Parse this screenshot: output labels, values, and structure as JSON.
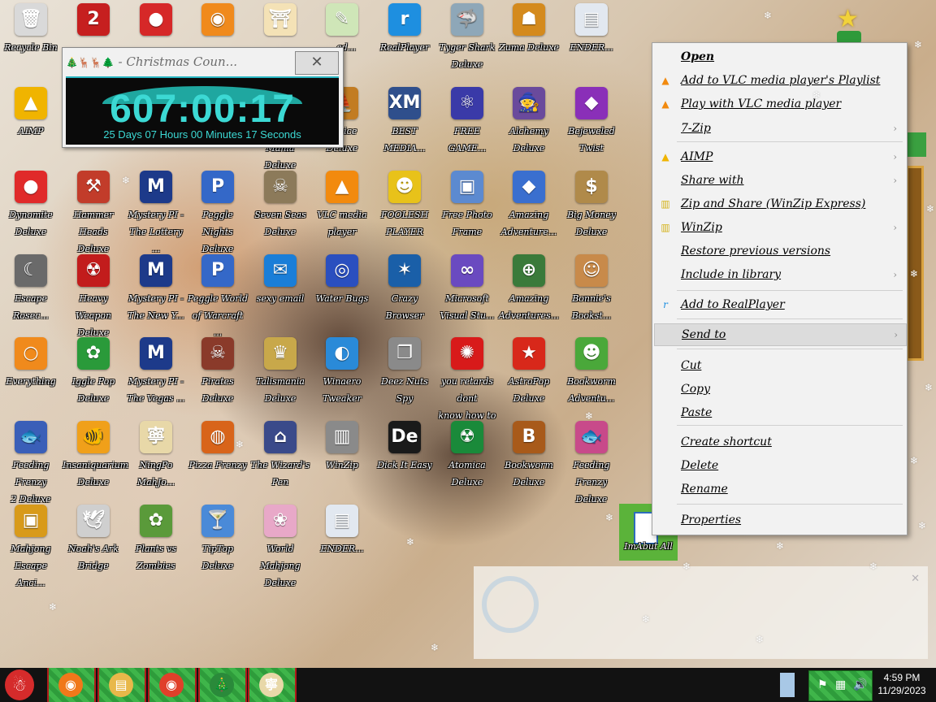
{
  "desktop": {
    "icons": [
      {
        "label": "Recycle Bin",
        "glyph": "🗑",
        "color": "#d9d9d9",
        "shortcut": false
      },
      {
        "label": "",
        "glyph": "2",
        "color": "#c61f1f",
        "shortcut": true
      },
      {
        "label": "",
        "glyph": "●",
        "color": "#d62828",
        "shortcut": true
      },
      {
        "label": "",
        "glyph": "◉",
        "color": "#f08a1c",
        "shortcut": true
      },
      {
        "label": "",
        "glyph": "⛩",
        "color": "#f4e2b6",
        "shortcut": true
      },
      {
        "label": "...ad...",
        "glyph": "✎",
        "color": "#cfe6b8",
        "shortcut": true
      },
      {
        "label": "RealPlayer",
        "glyph": "r",
        "color": "#1e8fe0",
        "shortcut": true
      },
      {
        "label": "Tyger Shark\nDeluxe",
        "glyph": "🦈",
        "color": "#8ea7b8",
        "shortcut": true
      },
      {
        "label": "Zuma Deluxe",
        "glyph": "☗",
        "color": "#d48a1d",
        "shortcut": true
      },
      {
        "label": "ENDER...",
        "glyph": "▤",
        "color": "#e2e8f0",
        "shortcut": true
      },
      {
        "label": "AIMP",
        "glyph": "▲",
        "color": "#f0b400",
        "shortcut": true
      },
      {
        "label": "Deluxe",
        "glyph": "",
        "color": "rgba(0,0,0,0)",
        "shortcut": false
      },
      {
        "label": "Deluxe",
        "glyph": "",
        "color": "rgba(0,0,0,0)",
        "shortcut": false
      },
      {
        "label": "Deluxe",
        "glyph": "",
        "color": "rgba(0,0,0,0)",
        "shortcut": false
      },
      {
        "label": "Rocket Mania\nDeluxe",
        "glyph": "✦",
        "color": "#1d4d2e",
        "shortcut": true
      },
      {
        "label": "Venice Deluxe",
        "glyph": "⛵",
        "color": "#c27c22",
        "shortcut": true
      },
      {
        "label": "BEST\nMEDIA...",
        "glyph": "XM",
        "color": "#2f4f8c",
        "shortcut": true
      },
      {
        "label": "FREE\nGAME...",
        "glyph": "⚛",
        "color": "#3a3aa8",
        "shortcut": true
      },
      {
        "label": "Alchemy\nDeluxe",
        "glyph": "🧙",
        "color": "#6a4a9c",
        "shortcut": true
      },
      {
        "label": "Bejeweled\nTwist",
        "glyph": "◆",
        "color": "#8a2fb8",
        "shortcut": true
      },
      {
        "label": "Dynomite\nDeluxe",
        "glyph": "●",
        "color": "#e02a2a",
        "shortcut": true
      },
      {
        "label": "Hammer Heads\nDeluxe",
        "glyph": "⚒",
        "color": "#c23c2a",
        "shortcut": true
      },
      {
        "label": "Mystery PI -\nThe Lottery ...",
        "glyph": "M",
        "color": "#1d3a8a",
        "shortcut": true
      },
      {
        "label": "Peggle Nights\nDeluxe",
        "glyph": "P",
        "color": "#3468c8",
        "shortcut": true
      },
      {
        "label": "Seven Seas\nDeluxe",
        "glyph": "☠",
        "color": "#8c7a5a",
        "shortcut": true
      },
      {
        "label": "VLC media\nplayer",
        "glyph": "▲",
        "color": "#f28a0e",
        "shortcut": true
      },
      {
        "label": "FOOLESH\nPLAYER",
        "glyph": "☻",
        "color": "#e8c21a",
        "shortcut": true
      },
      {
        "label": "Free Photo\nFrame",
        "glyph": "▣",
        "color": "#5c8ad0",
        "shortcut": true
      },
      {
        "label": "Amazing\nAdventure...",
        "glyph": "◆",
        "color": "#3a6fcf",
        "shortcut": true
      },
      {
        "label": "Big Money\nDeluxe",
        "glyph": "$",
        "color": "#b08a4a",
        "shortcut": true
      },
      {
        "label": "Escape\nRosec...",
        "glyph": "☾",
        "color": "#6a6a6a",
        "shortcut": true
      },
      {
        "label": "Heavy Weapon\nDeluxe",
        "glyph": "☢",
        "color": "#c21c1c",
        "shortcut": true
      },
      {
        "label": "Mystery PI -\nThe New Y...",
        "glyph": "M",
        "color": "#1d3a8a",
        "shortcut": true
      },
      {
        "label": "Peggle World\nof Warcraft ...",
        "glyph": "P",
        "color": "#3468c8",
        "shortcut": true
      },
      {
        "label": "sexy email",
        "glyph": "✉",
        "color": "#1a7ed8",
        "shortcut": true
      },
      {
        "label": "Water Bugs",
        "glyph": "◎",
        "color": "#2a4fbf",
        "shortcut": true
      },
      {
        "label": "Crazy Browser",
        "glyph": "✶",
        "color": "#1a5fa8",
        "shortcut": true
      },
      {
        "label": "Microsoft\nVisual Stu...",
        "glyph": "∞",
        "color": "#6a4ac0",
        "shortcut": true
      },
      {
        "label": "Amazing\nAdventures...",
        "glyph": "⊕",
        "color": "#3a7a3a",
        "shortcut": true
      },
      {
        "label": "Bonnie's\nBookst...",
        "glyph": "☺",
        "color": "#c88a4a",
        "shortcut": true
      },
      {
        "label": "Everything",
        "glyph": "○",
        "color": "#f08a1c",
        "shortcut": true
      },
      {
        "label": "Iggle Pop\nDeluxe",
        "glyph": "✿",
        "color": "#2a9a3a",
        "shortcut": true
      },
      {
        "label": "Mystery PI -\nThe Vegas ...",
        "glyph": "M",
        "color": "#1d3a8a",
        "shortcut": true
      },
      {
        "label": "Pirates Deluxe",
        "glyph": "☠",
        "color": "#8a3a2a",
        "shortcut": true
      },
      {
        "label": "Talismania\nDeluxe",
        "glyph": "♛",
        "color": "#c8a84a",
        "shortcut": true
      },
      {
        "label": "Winaero\nTweaker",
        "glyph": "◐",
        "color": "#2a8ad8",
        "shortcut": true
      },
      {
        "label": "Deez Nuts\nSpy",
        "glyph": "❐",
        "color": "#8a8a8a",
        "shortcut": true
      },
      {
        "label": "you retards dont\nknow how to ...",
        "glyph": "✺",
        "color": "#d81a1a",
        "shortcut": true
      },
      {
        "label": "AstroPop\nDeluxe",
        "glyph": "★",
        "color": "#d8281a",
        "shortcut": true
      },
      {
        "label": "Bookworm\nAdventu...",
        "glyph": "☻",
        "color": "#4aa83a",
        "shortcut": true
      },
      {
        "label": "Feeding Frenzy\n2 Deluxe",
        "glyph": "🐟",
        "color": "#3a5fb8",
        "shortcut": true
      },
      {
        "label": "Insaniquarium\nDeluxe",
        "glyph": "🐠",
        "color": "#f0a01a",
        "shortcut": true
      },
      {
        "label": "NingPo\nMahJo...",
        "glyph": "寧",
        "color": "#e8d8a8",
        "shortcut": true
      },
      {
        "label": "Pizza Frenzy",
        "glyph": "◍",
        "color": "#d8641a",
        "shortcut": true
      },
      {
        "label": "The Wizard's\nPen",
        "glyph": "⌂",
        "color": "#3a4a8a",
        "shortcut": true
      },
      {
        "label": "WinZip",
        "glyph": "▥",
        "color": "#8a8a8a",
        "shortcut": true
      },
      {
        "label": "Dick It Easy",
        "glyph": "De",
        "color": "#1a1a1a",
        "shortcut": true
      },
      {
        "label": "Atomica\nDeluxe",
        "glyph": "☢",
        "color": "#1a8a3a",
        "shortcut": true
      },
      {
        "label": "Bookworm\nDeluxe",
        "glyph": "B",
        "color": "#a85a1a",
        "shortcut": true
      },
      {
        "label": "Feeding Frenzy\nDeluxe",
        "glyph": "🐟",
        "color": "#c84a8a",
        "shortcut": true
      },
      {
        "label": "Mahjong\nEscape Anci...",
        "glyph": "▣",
        "color": "#d89a1a",
        "shortcut": true
      },
      {
        "label": "Noah's Ark\nBridge",
        "glyph": "🕊",
        "color": "#cfcfcf",
        "shortcut": true
      },
      {
        "label": "Plants vs\nZombies",
        "glyph": "✿",
        "color": "#5a9a3a",
        "shortcut": true
      },
      {
        "label": "TipTop Deluxe",
        "glyph": "🍸",
        "color": "#4a8ad8",
        "shortcut": true
      },
      {
        "label": "World Mahjong\nDeluxe",
        "glyph": "❀",
        "color": "#e8a8c8",
        "shortcut": true
      },
      {
        "label": "ENDER...",
        "glyph": "▤",
        "color": "#e2e8f0",
        "shortcut": true
      }
    ],
    "leftover_icon_label": "ImAbut All"
  },
  "countdown": {
    "title": "- Christmas Coun...",
    "title_glyphs": "🎄🦌🦌🌲",
    "close_glyph": "✕",
    "time": "607:00:17",
    "subtitle": "25 Days 07 Hours 00 Minutes 17 Seconds"
  },
  "context_menu": {
    "items": [
      {
        "label": "Open",
        "icon": "",
        "submenu": false,
        "bold": true
      },
      {
        "label": "Add to VLC media player's Playlist",
        "icon": "vlc-icon",
        "submenu": false
      },
      {
        "label": "Play with VLC media player",
        "icon": "vlc-icon",
        "submenu": false
      },
      {
        "label": "7-Zip",
        "icon": "",
        "submenu": true
      },
      {
        "label": "AIMP",
        "icon": "aimp-icon",
        "submenu": true
      },
      {
        "label": "Share with",
        "icon": "",
        "submenu": true
      },
      {
        "label": "Zip and Share (WinZip Express)",
        "icon": "winzip-icon",
        "submenu": false
      },
      {
        "label": "WinZip",
        "icon": "winzip-icon",
        "submenu": true
      },
      {
        "label": "Restore previous versions",
        "icon": "",
        "submenu": false
      },
      {
        "label": "Include in library",
        "icon": "",
        "submenu": true
      },
      {
        "label": "Add to RealPlayer",
        "icon": "realplayer-icon",
        "submenu": false
      },
      {
        "label": "Send to",
        "icon": "",
        "submenu": true
      },
      {
        "label": "Cut",
        "icon": "",
        "submenu": false
      },
      {
        "label": "Copy",
        "icon": "",
        "submenu": false
      },
      {
        "label": "Paste",
        "icon": "",
        "submenu": false
      },
      {
        "label": "Create shortcut",
        "icon": "",
        "submenu": false
      },
      {
        "label": "Delete",
        "icon": "",
        "submenu": false
      },
      {
        "label": "Rename",
        "icon": "",
        "submenu": false
      },
      {
        "label": "Properties",
        "icon": "",
        "submenu": false
      }
    ],
    "highlighted": "Send to",
    "submenu_arrow": "›"
  },
  "notification": {
    "close_glyph": "✕"
  },
  "taskbar": {
    "clock_time": "4:59 PM",
    "clock_date": "11/29/2023",
    "buttons": [
      {
        "name": "firefox",
        "glyph": "◉",
        "color": "#f0781a"
      },
      {
        "name": "file-explorer",
        "glyph": "▤",
        "color": "#e8b84a"
      },
      {
        "name": "chrome",
        "glyph": "◉",
        "color": "#e0402a"
      },
      {
        "name": "christmas-tree",
        "glyph": "🎄",
        "color": "#2a8a3a"
      },
      {
        "name": "ningpo",
        "glyph": "寧",
        "color": "#e8d8a8"
      }
    ],
    "start_glyph": "☃"
  },
  "colors": {
    "taskbar_bg": "#121212",
    "countdown_digits": "#3cd9d4",
    "menu_bg": "#f2f2f2"
  }
}
